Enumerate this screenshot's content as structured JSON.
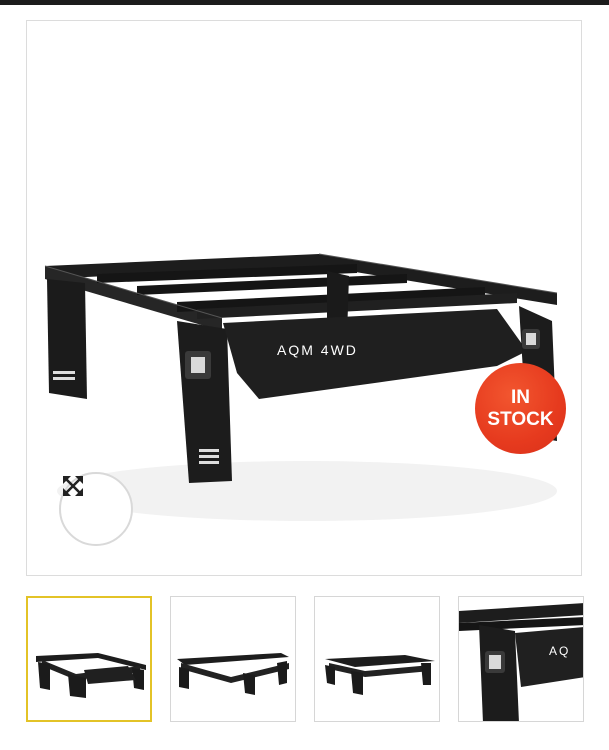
{
  "product_image": {
    "alt_brand_text": "AQM 4WD",
    "badge": {
      "line1": "IN",
      "line2": "STOCK",
      "color": "#e63a1e"
    },
    "zoom_icon": "expand-arrows-icon"
  },
  "thumbnails": [
    {
      "name": "thumbnail-1",
      "active": true,
      "border_color": "#e3c327"
    },
    {
      "name": "thumbnail-2",
      "active": false
    },
    {
      "name": "thumbnail-3",
      "active": false
    },
    {
      "name": "thumbnail-4",
      "active": false,
      "brand_text": "AQ"
    }
  ]
}
